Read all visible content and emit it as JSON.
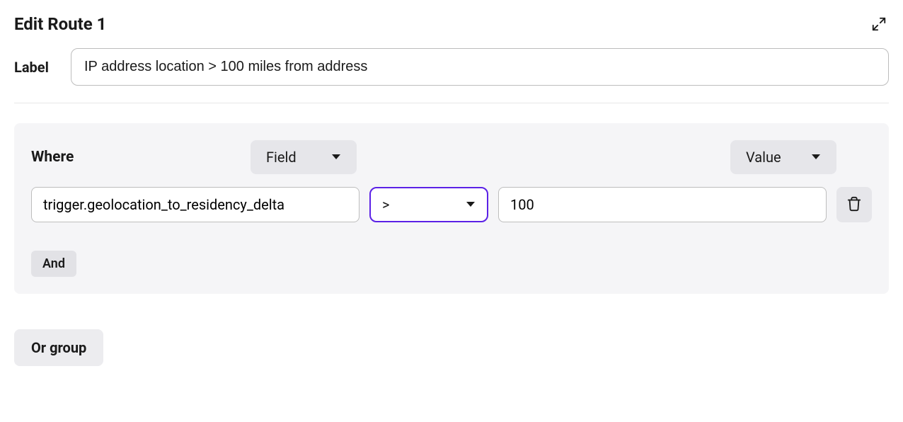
{
  "header": {
    "title": "Edit Route 1"
  },
  "label": {
    "caption": "Label",
    "value": "IP address location > 100 miles from address"
  },
  "where": {
    "caption": "Where",
    "field_dropdown": "Field",
    "value_dropdown": "Value",
    "condition": {
      "field": "trigger.geolocation_to_residency_delta",
      "operator": ">",
      "value": "100"
    },
    "and_button": "And"
  },
  "or_group_button": "Or group"
}
